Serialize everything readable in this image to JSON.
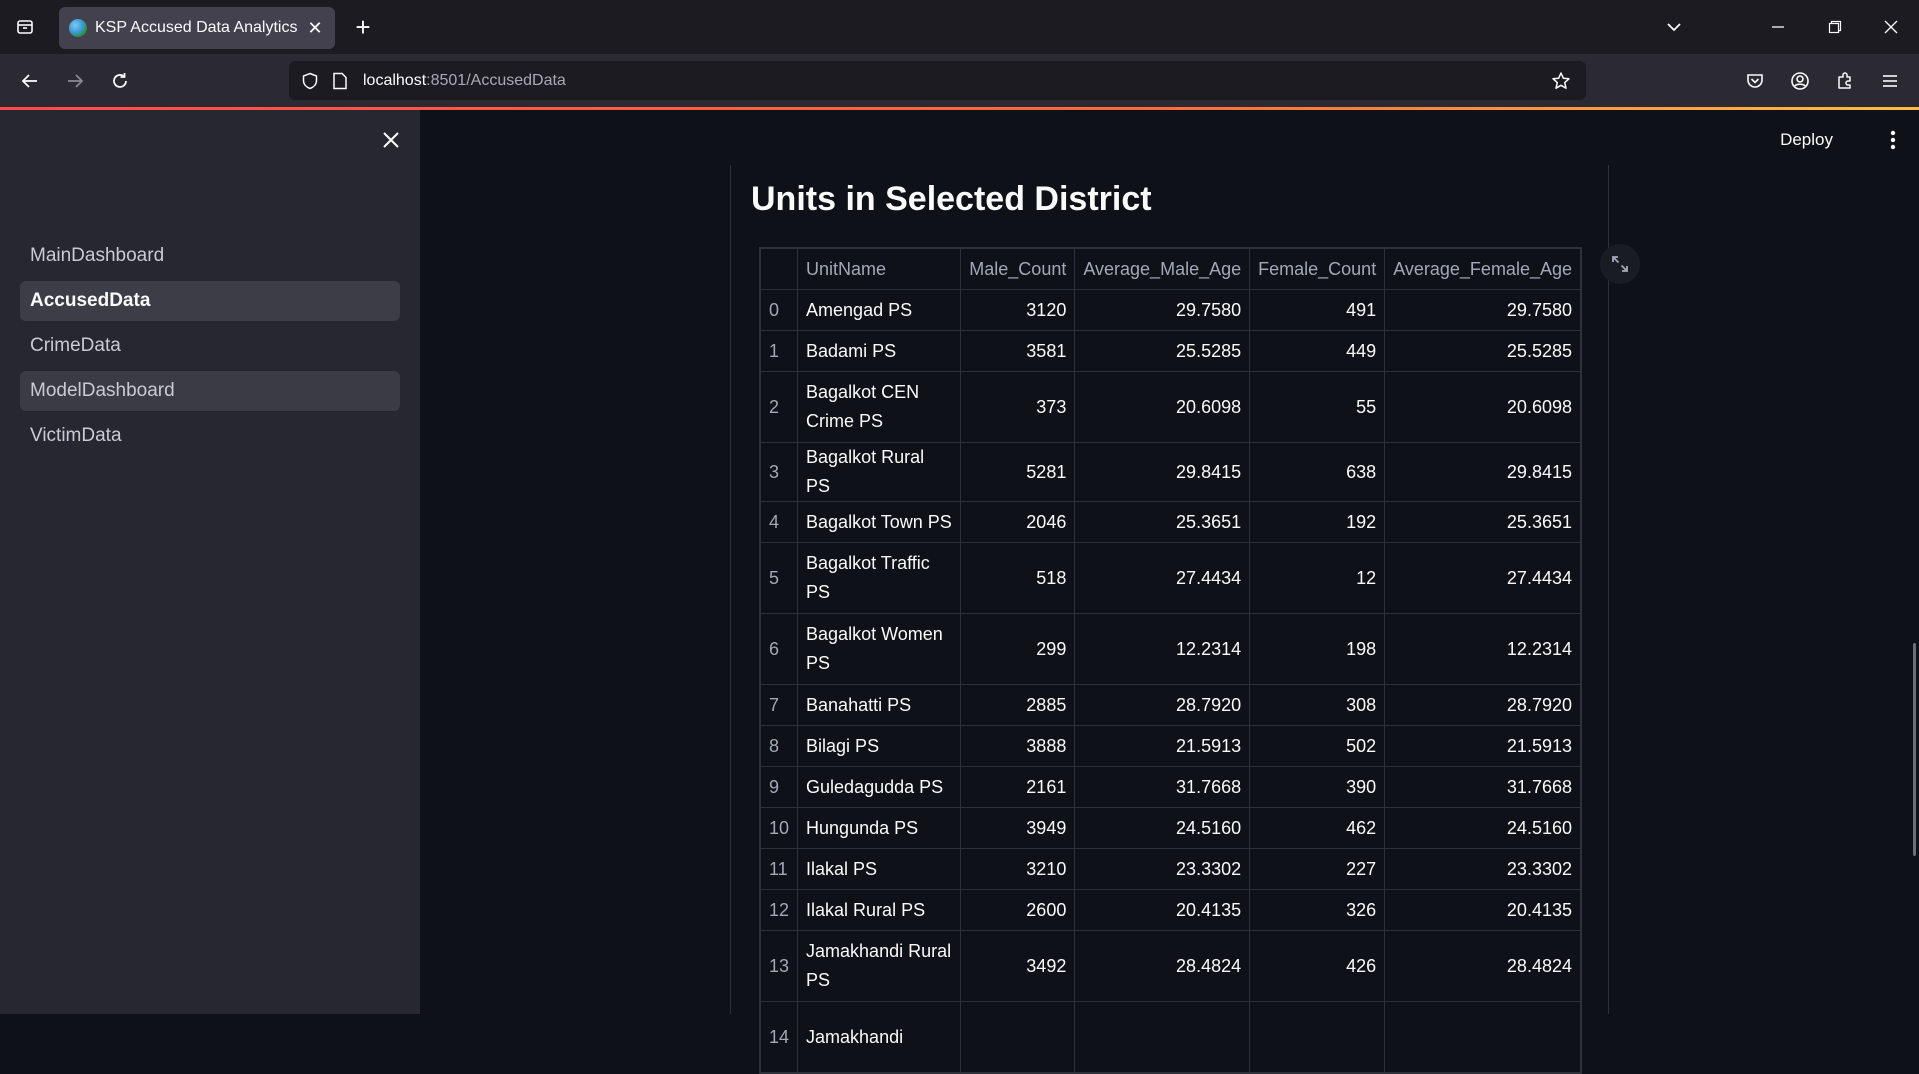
{
  "browser": {
    "tab_title": "KSP Accused Data Analytics",
    "url_host": "localhost",
    "url_rest": ":8501/AccusedData"
  },
  "app": {
    "deploy_label": "Deploy",
    "sidebar": {
      "items": [
        {
          "label": "MainDashboard"
        },
        {
          "label": "AccusedData"
        },
        {
          "label": "CrimeData"
        },
        {
          "label": "ModelDashboard"
        },
        {
          "label": "VictimData"
        }
      ]
    },
    "section_title": "Units in Selected District",
    "table": {
      "columns": [
        "",
        "UnitName",
        "Male_Count",
        "Average_Male_Age",
        "Female_Count",
        "Average_Female_Age"
      ],
      "rows": [
        {
          "idx": "0",
          "name": "Amengad PS",
          "male_count": "3120",
          "avg_male_age": "29.7580",
          "female_count": "491",
          "avg_female_age": "29.7580"
        },
        {
          "idx": "1",
          "name": "Badami PS",
          "male_count": "3581",
          "avg_male_age": "25.5285",
          "female_count": "449",
          "avg_female_age": "25.5285"
        },
        {
          "idx": "2",
          "name": "Bagalkot CEN Crime PS",
          "male_count": "373",
          "avg_male_age": "20.6098",
          "female_count": "55",
          "avg_female_age": "20.6098"
        },
        {
          "idx": "3",
          "name": "Bagalkot Rural PS",
          "male_count": "5281",
          "avg_male_age": "29.8415",
          "female_count": "638",
          "avg_female_age": "29.8415"
        },
        {
          "idx": "4",
          "name": "Bagalkot Town PS",
          "male_count": "2046",
          "avg_male_age": "25.3651",
          "female_count": "192",
          "avg_female_age": "25.3651"
        },
        {
          "idx": "5",
          "name": "Bagalkot Traffic PS",
          "male_count": "518",
          "avg_male_age": "27.4434",
          "female_count": "12",
          "avg_female_age": "27.4434"
        },
        {
          "idx": "6",
          "name": "Bagalkot Women PS",
          "male_count": "299",
          "avg_male_age": "12.2314",
          "female_count": "198",
          "avg_female_age": "12.2314"
        },
        {
          "idx": "7",
          "name": "Banahatti PS",
          "male_count": "2885",
          "avg_male_age": "28.7920",
          "female_count": "308",
          "avg_female_age": "28.7920"
        },
        {
          "idx": "8",
          "name": "Bilagi PS",
          "male_count": "3888",
          "avg_male_age": "21.5913",
          "female_count": "502",
          "avg_female_age": "21.5913"
        },
        {
          "idx": "9",
          "name": "Guledagudda PS",
          "male_count": "2161",
          "avg_male_age": "31.7668",
          "female_count": "390",
          "avg_female_age": "31.7668"
        },
        {
          "idx": "10",
          "name": "Hungunda PS",
          "male_count": "3949",
          "avg_male_age": "24.5160",
          "female_count": "462",
          "avg_female_age": "24.5160"
        },
        {
          "idx": "11",
          "name": "Ilakal PS",
          "male_count": "3210",
          "avg_male_age": "23.3302",
          "female_count": "227",
          "avg_female_age": "23.3302"
        },
        {
          "idx": "12",
          "name": "Ilakal Rural PS",
          "male_count": "2600",
          "avg_male_age": "20.4135",
          "female_count": "326",
          "avg_female_age": "20.4135"
        },
        {
          "idx": "13",
          "name": "Jamakhandi Rural PS",
          "male_count": "3492",
          "avg_male_age": "28.4824",
          "female_count": "426",
          "avg_female_age": "28.4824"
        },
        {
          "idx": "14",
          "name": "Jamakhandi",
          "male_count": "",
          "avg_male_age": "",
          "female_count": "",
          "avg_female_age": ""
        }
      ]
    }
  }
}
